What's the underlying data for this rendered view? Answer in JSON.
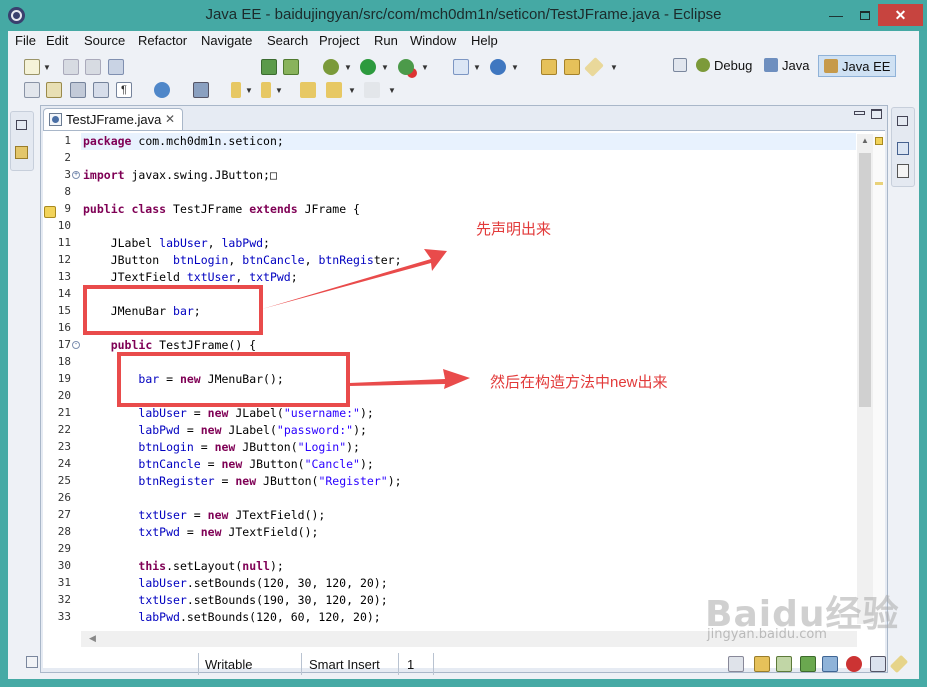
{
  "window": {
    "title": "Java EE - baidujingyan/src/com/mch0dm1n/seticon/TestJFrame.java - Eclipse",
    "minimize": "—",
    "close": "✕"
  },
  "menu": [
    "File",
    "Edit",
    "Source",
    "Refactor",
    "Navigate",
    "Search",
    "Project",
    "Run",
    "Window",
    "Help"
  ],
  "perspectives": {
    "debug": "Debug",
    "java": "Java",
    "javaee": "Java EE"
  },
  "editor": {
    "tab_label": "TestJFrame.java",
    "tab_close": "✕",
    "lines": [
      {
        "n": "1",
        "fold": "",
        "segments": [
          {
            "t": "package",
            "c": "kw"
          },
          {
            "t": " com.mch0dm1n.seticon;",
            "c": ""
          }
        ]
      },
      {
        "n": "2",
        "fold": "",
        "segments": []
      },
      {
        "n": "3",
        "fold": "+",
        "segments": [
          {
            "t": "import",
            "c": "kw"
          },
          {
            "t": " javax.swing.JButton;",
            "c": ""
          },
          {
            "t": "□",
            "c": ""
          }
        ]
      },
      {
        "n": "8",
        "fold": "",
        "segments": []
      },
      {
        "n": "9",
        "fold": "",
        "segments": [
          {
            "t": "public class",
            "c": "kw"
          },
          {
            "t": " TestJFrame ",
            "c": ""
          },
          {
            "t": "extends",
            "c": "kw"
          },
          {
            "t": " JFrame {",
            "c": ""
          }
        ]
      },
      {
        "n": "10",
        "fold": "",
        "segments": []
      },
      {
        "n": "11",
        "fold": "",
        "segments": [
          {
            "t": "    JLabel ",
            "c": ""
          },
          {
            "t": "labUser",
            "c": "fld"
          },
          {
            "t": ", ",
            "c": ""
          },
          {
            "t": "labPwd",
            "c": "fld"
          },
          {
            "t": ";",
            "c": ""
          }
        ]
      },
      {
        "n": "12",
        "fold": "",
        "segments": [
          {
            "t": "    JButton  ",
            "c": ""
          },
          {
            "t": "btnLogin",
            "c": "fld"
          },
          {
            "t": ", ",
            "c": ""
          },
          {
            "t": "btnCancle",
            "c": "fld"
          },
          {
            "t": ", ",
            "c": ""
          },
          {
            "t": "btnRegis",
            "c": "fld"
          },
          {
            "t": "ter;",
            "c": ""
          }
        ]
      },
      {
        "n": "13",
        "fold": "",
        "segments": [
          {
            "t": "    JTextField ",
            "c": ""
          },
          {
            "t": "txtUser",
            "c": "fld"
          },
          {
            "t": ", ",
            "c": ""
          },
          {
            "t": "txtPwd",
            "c": "fld"
          },
          {
            "t": ";",
            "c": ""
          }
        ]
      },
      {
        "n": "14",
        "fold": "",
        "segments": []
      },
      {
        "n": "15",
        "fold": "",
        "segments": [
          {
            "t": "    JMenuBar ",
            "c": ""
          },
          {
            "t": "bar",
            "c": "fld"
          },
          {
            "t": ";",
            "c": ""
          }
        ]
      },
      {
        "n": "16",
        "fold": "",
        "segments": []
      },
      {
        "n": "17",
        "fold": "-",
        "segments": [
          {
            "t": "    ",
            "c": ""
          },
          {
            "t": "public",
            "c": "kw"
          },
          {
            "t": " TestJFrame() {",
            "c": ""
          }
        ]
      },
      {
        "n": "18",
        "fold": "",
        "segments": []
      },
      {
        "n": "19",
        "fold": "",
        "segments": [
          {
            "t": "        ",
            "c": ""
          },
          {
            "t": "bar",
            "c": "fld"
          },
          {
            "t": " = ",
            "c": ""
          },
          {
            "t": "new",
            "c": "kw"
          },
          {
            "t": " JMenuBar();",
            "c": ""
          }
        ]
      },
      {
        "n": "20",
        "fold": "",
        "segments": []
      },
      {
        "n": "21",
        "fold": "",
        "segments": [
          {
            "t": "        ",
            "c": ""
          },
          {
            "t": "labUser",
            "c": "fld"
          },
          {
            "t": " = ",
            "c": ""
          },
          {
            "t": "new",
            "c": "kw"
          },
          {
            "t": " JLabel(",
            "c": ""
          },
          {
            "t": "\"username:\"",
            "c": "str"
          },
          {
            "t": ");",
            "c": ""
          }
        ]
      },
      {
        "n": "22",
        "fold": "",
        "segments": [
          {
            "t": "        ",
            "c": ""
          },
          {
            "t": "labPwd",
            "c": "fld"
          },
          {
            "t": " = ",
            "c": ""
          },
          {
            "t": "new",
            "c": "kw"
          },
          {
            "t": " JLabel(",
            "c": ""
          },
          {
            "t": "\"password:\"",
            "c": "str"
          },
          {
            "t": ");",
            "c": ""
          }
        ]
      },
      {
        "n": "23",
        "fold": "",
        "segments": [
          {
            "t": "        ",
            "c": ""
          },
          {
            "t": "btnLogin",
            "c": "fld"
          },
          {
            "t": " = ",
            "c": ""
          },
          {
            "t": "new",
            "c": "kw"
          },
          {
            "t": " JButton(",
            "c": ""
          },
          {
            "t": "\"Login\"",
            "c": "str"
          },
          {
            "t": ");",
            "c": ""
          }
        ]
      },
      {
        "n": "24",
        "fold": "",
        "segments": [
          {
            "t": "        ",
            "c": ""
          },
          {
            "t": "btnCancle",
            "c": "fld"
          },
          {
            "t": " = ",
            "c": ""
          },
          {
            "t": "new",
            "c": "kw"
          },
          {
            "t": " JButton(",
            "c": ""
          },
          {
            "t": "\"Cancle\"",
            "c": "str"
          },
          {
            "t": ");",
            "c": ""
          }
        ]
      },
      {
        "n": "25",
        "fold": "",
        "segments": [
          {
            "t": "        ",
            "c": ""
          },
          {
            "t": "btnRegister",
            "c": "fld"
          },
          {
            "t": " = ",
            "c": ""
          },
          {
            "t": "new",
            "c": "kw"
          },
          {
            "t": " JButton(",
            "c": ""
          },
          {
            "t": "\"Register\"",
            "c": "str"
          },
          {
            "t": ");",
            "c": ""
          }
        ]
      },
      {
        "n": "26",
        "fold": "",
        "segments": []
      },
      {
        "n": "27",
        "fold": "",
        "segments": [
          {
            "t": "        ",
            "c": ""
          },
          {
            "t": "txtUser",
            "c": "fld"
          },
          {
            "t": " = ",
            "c": ""
          },
          {
            "t": "new",
            "c": "kw"
          },
          {
            "t": " JTextField();",
            "c": ""
          }
        ]
      },
      {
        "n": "28",
        "fold": "",
        "segments": [
          {
            "t": "        ",
            "c": ""
          },
          {
            "t": "txtPwd",
            "c": "fld"
          },
          {
            "t": " = ",
            "c": ""
          },
          {
            "t": "new",
            "c": "kw"
          },
          {
            "t": " JTextField();",
            "c": ""
          }
        ]
      },
      {
        "n": "29",
        "fold": "",
        "segments": []
      },
      {
        "n": "30",
        "fold": "",
        "segments": [
          {
            "t": "        ",
            "c": ""
          },
          {
            "t": "this",
            "c": "kw"
          },
          {
            "t": ".setLayout(",
            "c": ""
          },
          {
            "t": "null",
            "c": "kw"
          },
          {
            "t": ");",
            "c": ""
          }
        ]
      },
      {
        "n": "31",
        "fold": "",
        "segments": [
          {
            "t": "        ",
            "c": ""
          },
          {
            "t": "labUser",
            "c": "fld"
          },
          {
            "t": ".setBounds(120, 30, 120, 20);",
            "c": ""
          }
        ]
      },
      {
        "n": "32",
        "fold": "",
        "segments": [
          {
            "t": "        ",
            "c": ""
          },
          {
            "t": "txtUser",
            "c": "fld"
          },
          {
            "t": ".setBounds(190, 30, 120, 20);",
            "c": ""
          }
        ]
      },
      {
        "n": "33",
        "fold": "",
        "segments": [
          {
            "t": "        ",
            "c": ""
          },
          {
            "t": "labPwd",
            "c": "fld"
          },
          {
            "t": ".setBounds(120, 60, 120, 20);",
            "c": ""
          }
        ]
      }
    ]
  },
  "annotations": {
    "declare_note": "先声明出来",
    "construct_note": "然后在构造方法中new出来"
  },
  "status": {
    "writable": "Writable",
    "insert_mode": "Smart Insert",
    "position": "1"
  },
  "watermark": {
    "logo": "Baidu经验",
    "url": "jingyan.baidu.com"
  },
  "colors": {
    "keyword": "#7f0055",
    "string": "#2a00ff",
    "field": "#0000c0",
    "annotation": "#e94b4b",
    "titlebar": "#45a9a4",
    "close_button": "#c7443f"
  }
}
